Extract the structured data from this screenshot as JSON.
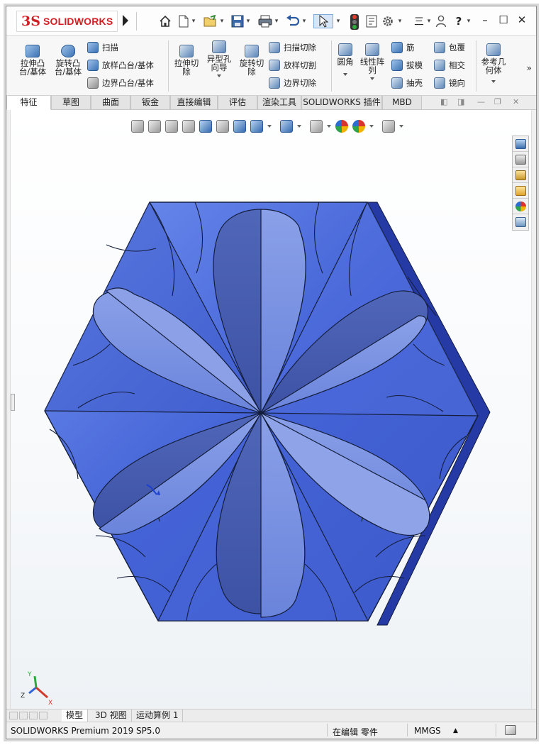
{
  "app": {
    "logo_mark": "3S",
    "logo_text": "SOLIDWORKS"
  },
  "toolbar": {
    "icons": [
      "home-icon",
      "new-file-icon",
      "open-file-icon",
      "save-icon",
      "print-icon",
      "undo-icon",
      "select-arrow-icon",
      "rebuild-traffic-light-icon",
      "file-properties-icon",
      "options-gear-icon",
      "menu-icon",
      "user-icon",
      "help-icon"
    ],
    "menu_label": "三",
    "help_label": "?",
    "window_buttons": [
      "–",
      "☐",
      "✕"
    ]
  },
  "ribbon": {
    "big_buttons": [
      {
        "label_1": "拉伸凸",
        "label_2": "台/基体"
      },
      {
        "label_1": "旋转凸",
        "label_2": "台/基体"
      },
      {
        "label_1": "拉伸切",
        "label_2": "除"
      },
      {
        "label_1": "异型孔",
        "label_2": "向导"
      },
      {
        "label_1": "旋转切",
        "label_2": "除"
      },
      {
        "label_1": "圆角",
        "label_2": ""
      },
      {
        "label_1": "线性阵",
        "label_2": "列"
      },
      {
        "label_1": "参考几",
        "label_2": "何体"
      }
    ],
    "small_buttons": [
      "扫描",
      "放样凸台/基体",
      "边界凸台/基体",
      "扫描切除",
      "放样切割",
      "边界切除",
      "筋",
      "拔模",
      "抽壳",
      "包覆",
      "相交",
      "镜向"
    ],
    "more": "»"
  },
  "tabs": [
    "特征",
    "草图",
    "曲面",
    "钣金",
    "直接编辑",
    "评估",
    "渲染工具",
    "SOLIDWORKS 插件",
    "MBD"
  ],
  "active_tab": "特征",
  "heads_up_toolbar": [
    "view-orientation-icon",
    "zoom-to-fit-icon",
    "zoom-to-area-icon",
    "previous-view-icon",
    "section-view-icon",
    "dynamic-annotation-icon",
    "view-orientation-cube-icon",
    "display-style-icon",
    "hide-show-items-icon",
    "edit-appearance-icon",
    "apply-scene-icon",
    "view-settings-icon",
    "display-icon"
  ],
  "task_pane": [
    "solidworks-resources-icon",
    "design-library-icon",
    "file-explorer-icon",
    "view-palette-icon",
    "appearances-icon",
    "custom-properties-icon"
  ],
  "model": {
    "face_color": "#4a6fd8",
    "edge_color": "#141e3c",
    "side_color": "#2c3ea8"
  },
  "triad": {
    "x_label": "X",
    "y_label": "Y",
    "z_label": "Z"
  },
  "model_tabs": [
    "模型",
    "3D 视图",
    "运动算例 1"
  ],
  "status": {
    "product": "SOLIDWORKS Premium 2019 SP5.0",
    "mode": "在编辑 零件",
    "units": "MMGS",
    "units_arrow": "▲"
  }
}
